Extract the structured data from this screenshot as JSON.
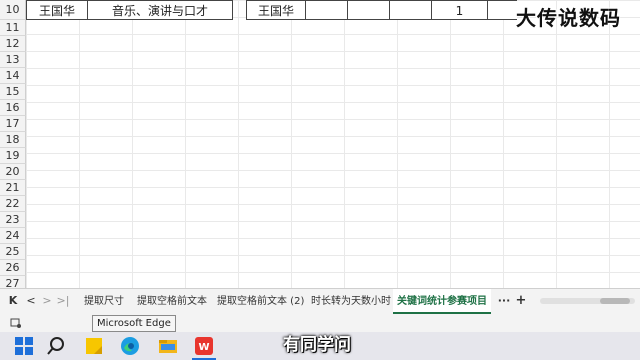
{
  "spreadsheet": {
    "row10": {
      "num": "10",
      "c1": "王国华",
      "c2": "音乐、演讲与口才",
      "c3": "王国华",
      "c4": "1"
    },
    "rows": [
      "11",
      "12",
      "13",
      "14",
      "15",
      "16",
      "17",
      "18",
      "19",
      "20",
      "21",
      "22",
      "23",
      "24",
      "25",
      "26",
      "27"
    ]
  },
  "watermark": "大传说数码",
  "tabs": {
    "nav": [
      "K",
      "<",
      ">",
      ">|"
    ],
    "sheets": [
      "提取尺寸",
      "提取空格前文本",
      "提取空格前文本 (2)",
      "时长转为天数小时",
      "关键词统计参赛项目"
    ],
    "more": "···",
    "add": "+"
  },
  "tooltip": "Microsoft Edge",
  "subtitle": "有同学问",
  "taskbar": {
    "icons": [
      "windows-start-icon",
      "search-icon",
      "sticky-notes-icon",
      "edge-icon",
      "file-explorer-icon",
      "wps-office-icon"
    ]
  },
  "colors": {
    "accent": "#1e7145",
    "wps": "#e8352e"
  }
}
